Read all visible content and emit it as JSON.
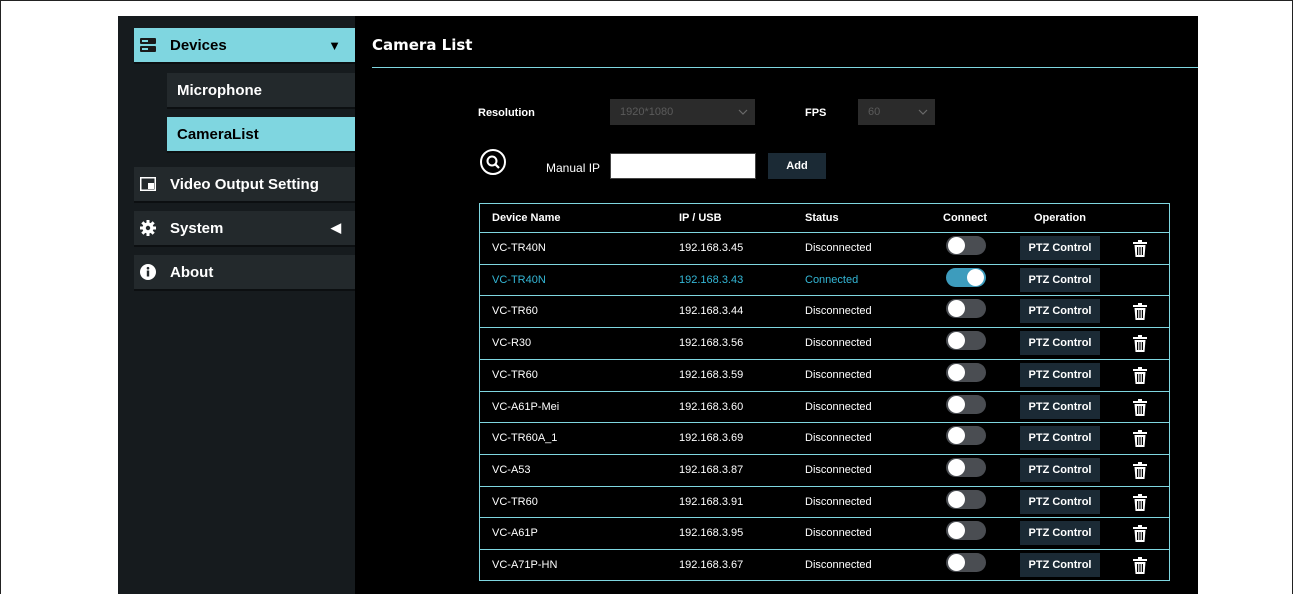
{
  "sidebar": {
    "devices": {
      "label": "Devices",
      "icon": "server-icon"
    },
    "microphone": {
      "label": "Microphone"
    },
    "camera_list": {
      "label": "CameraList"
    },
    "video_output": {
      "label": "Video Output Setting",
      "icon": "display-icon"
    },
    "system": {
      "label": "System",
      "icon": "gear-icon"
    },
    "about": {
      "label": "About",
      "icon": "info-icon"
    }
  },
  "main": {
    "title": "Camera List",
    "resolution": {
      "label": "Resolution",
      "value": "1920*1080"
    },
    "fps": {
      "label": "FPS",
      "value": "60"
    },
    "manual_ip": {
      "label": "Manual IP",
      "value": ""
    },
    "add_label": "Add"
  },
  "table": {
    "headers": {
      "device_name": "Device Name",
      "ip_usb": "IP / USB",
      "status": "Status",
      "connect": "Connect",
      "operation": "Operation"
    },
    "ptz_label": "PTZ Control",
    "rows": [
      {
        "name": "VC-TR40N",
        "ip": "192.168.3.45",
        "status": "Disconnected",
        "connected": false
      },
      {
        "name": "VC-TR40N",
        "ip": "192.168.3.43",
        "status": "Connected",
        "connected": true
      },
      {
        "name": "VC-TR60",
        "ip": "192.168.3.44",
        "status": "Disconnected",
        "connected": false
      },
      {
        "name": "VC-R30",
        "ip": "192.168.3.56",
        "status": "Disconnected",
        "connected": false
      },
      {
        "name": "VC-TR60",
        "ip": "192.168.3.59",
        "status": "Disconnected",
        "connected": false
      },
      {
        "name": "VC-A61P-Mei",
        "ip": "192.168.3.60",
        "status": "Disconnected",
        "connected": false
      },
      {
        "name": "VC-TR60A_1",
        "ip": "192.168.3.69",
        "status": "Disconnected",
        "connected": false
      },
      {
        "name": "VC-A53",
        "ip": "192.168.3.87",
        "status": "Disconnected",
        "connected": false
      },
      {
        "name": "VC-TR60",
        "ip": "192.168.3.91",
        "status": "Disconnected",
        "connected": false
      },
      {
        "name": "VC-A61P",
        "ip": "192.168.3.95",
        "status": "Disconnected",
        "connected": false
      },
      {
        "name": "VC-A71P-HN",
        "ip": "192.168.3.67",
        "status": "Disconnected",
        "connected": false
      }
    ]
  },
  "colors": {
    "accent": "#7fd6e0",
    "connected_text": "#34b7d6",
    "toggle_on": "#3d9cbd",
    "button_bg": "#1b2a35"
  }
}
